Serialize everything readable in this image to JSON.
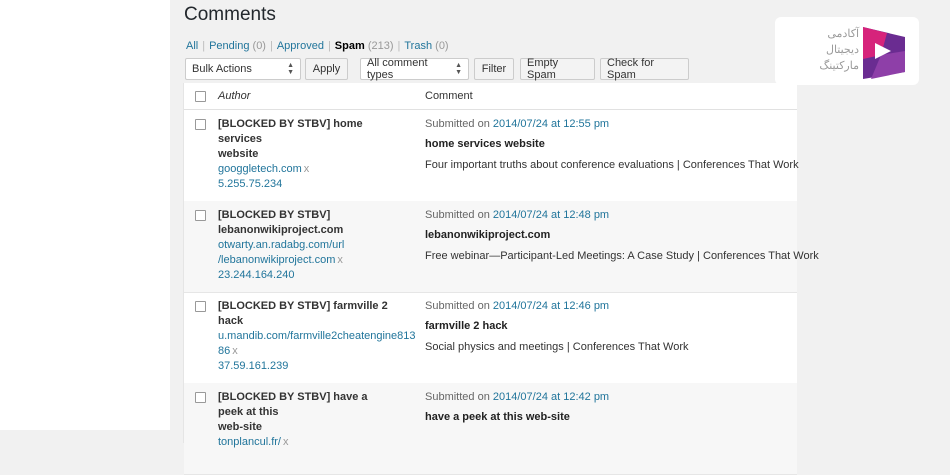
{
  "page": {
    "title": "Comments"
  },
  "filters": {
    "all": "All",
    "pending": "Pending",
    "pending_count": "(0)",
    "approved": "Approved",
    "spam": "Spam",
    "spam_count": "(213)",
    "trash": "Trash",
    "trash_count": "(0)"
  },
  "toolbar": {
    "bulk_actions": "Bulk Actions",
    "apply": "Apply",
    "comment_types": "All comment types",
    "filter": "Filter",
    "empty_spam": "Empty Spam",
    "check_spam": "Check for Spam"
  },
  "table": {
    "col_author": "Author",
    "col_comment": "Comment",
    "rows": [
      {
        "author_lines": [
          "[BLOCKED BY STBV] home services",
          "website"
        ],
        "url_lines": [
          "googgletech.com"
        ],
        "ip": "5.255.75.234",
        "submitted_prefix": "Submitted on",
        "date": "2014/07/24 at 12:55 pm",
        "title": "home services website",
        "body": "Four important truths about conference evaluations | Conferences That Work"
      },
      {
        "author_lines": [
          "[BLOCKED BY STBV]",
          "lebanonwikiproject.com"
        ],
        "url_lines": [
          "otwarty.an.radabg.com/url",
          "/lebanonwikiproject.com"
        ],
        "ip": "23.244.164.240",
        "submitted_prefix": "Submitted on",
        "date": "2014/07/24 at 12:48 pm",
        "title": "lebanonwikiproject.com",
        "body": "Free webinar—Participant-Led Meetings: A Case Study | Conferences That Work"
      },
      {
        "author_lines": [
          "[BLOCKED BY STBV] farmville 2 hack"
        ],
        "url_lines": [
          "u.mandib.com/farmville2cheatengine813",
          "86"
        ],
        "ip": "37.59.161.239",
        "submitted_prefix": "Submitted on",
        "date": "2014/07/24 at 12:46 pm",
        "title": "farmville 2 hack",
        "body": "Social physics and meetings | Conferences That Work"
      },
      {
        "author_lines": [
          "[BLOCKED BY STBV] have a peek at this",
          "web-site"
        ],
        "url_lines": [
          "tonplancul.fr/"
        ],
        "ip": "",
        "submitted_prefix": "Submitted on",
        "date": "2014/07/24 at 12:42 pm",
        "title": "have a peek at this web-site",
        "body": ""
      }
    ]
  },
  "remove_glyph": "x",
  "logo": {
    "line1": "آکادمی",
    "line2": "دیجیتال",
    "line3": "مارکتینگ"
  },
  "colors": {
    "link": "#21759b",
    "logo_pink": "#d6237b",
    "logo_purple": "#6a2c91"
  }
}
